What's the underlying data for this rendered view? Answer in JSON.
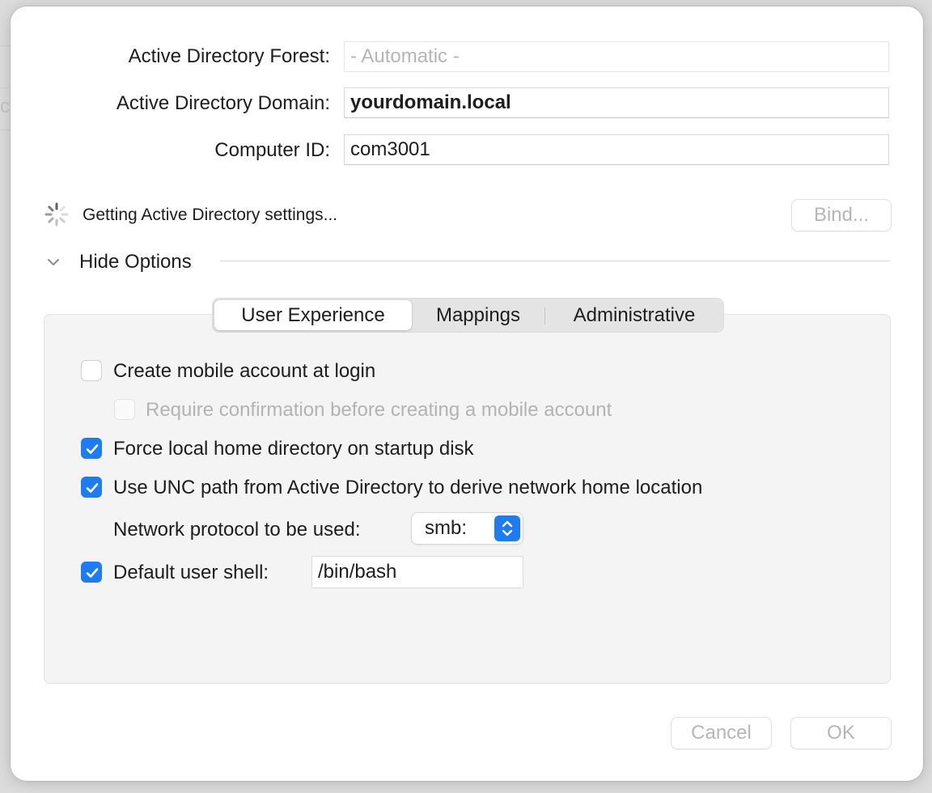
{
  "form": {
    "forest_label": "Active Directory Forest:",
    "forest_placeholder": "- Automatic -",
    "domain_label": "Active Directory Domain:",
    "domain_value": "yourdomain.local",
    "computer_id_label": "Computer ID:",
    "computer_id_value": "com3001"
  },
  "status": {
    "text": "Getting Active Directory settings...",
    "bind_label": "Bind..."
  },
  "options": {
    "toggle_label": "Hide Options",
    "tabs": [
      {
        "label": "User Experience",
        "active": true
      },
      {
        "label": "Mappings",
        "active": false
      },
      {
        "label": "Administrative",
        "active": false
      }
    ],
    "items": [
      {
        "label": "Create mobile account at login",
        "checked": false,
        "enabled": true
      },
      {
        "label": "Require confirmation before creating a mobile account",
        "checked": false,
        "enabled": false
      },
      {
        "label": "Force local home directory on startup disk",
        "checked": true,
        "enabled": true
      },
      {
        "label": "Use UNC path from Active Directory to derive network home location",
        "checked": true,
        "enabled": true
      }
    ],
    "protocol_label": "Network protocol to be used:",
    "protocol_value": "smb:",
    "shell_checked": true,
    "shell_label": "Default user shell:",
    "shell_value": "/bin/bash"
  },
  "footer": {
    "cancel_label": "Cancel",
    "ok_label": "OK"
  },
  "colors": {
    "accent": "#1e7cf2",
    "disabled_text": "#b6b6b6",
    "panel_bg": "#f4f4f4"
  }
}
